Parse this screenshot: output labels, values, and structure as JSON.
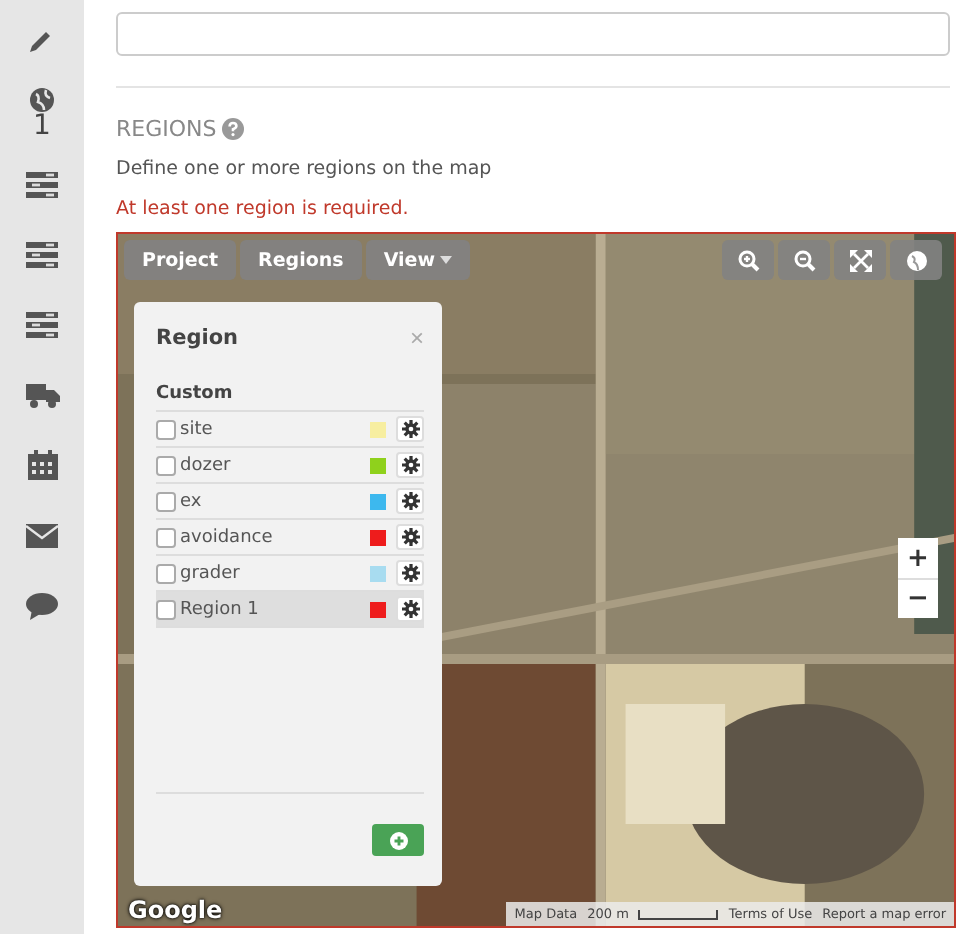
{
  "sidebar": {
    "items": [
      {
        "kind": "pencil"
      },
      {
        "kind": "globe",
        "count": "1"
      },
      {
        "kind": "list"
      },
      {
        "kind": "list"
      },
      {
        "kind": "list"
      },
      {
        "kind": "truck"
      },
      {
        "kind": "calendar"
      },
      {
        "kind": "envelope"
      },
      {
        "kind": "chat"
      }
    ]
  },
  "section": {
    "title": "REGIONS",
    "description": "Define one or more regions on the map",
    "error": "At least one region is required."
  },
  "map": {
    "toolbar": [
      {
        "label": "Project",
        "caret": false
      },
      {
        "label": "Regions",
        "caret": false
      },
      {
        "label": "View",
        "caret": true
      }
    ],
    "tools": [
      {
        "kind": "zoom-in"
      },
      {
        "kind": "zoom-out"
      },
      {
        "kind": "fullscreen"
      },
      {
        "kind": "globe"
      }
    ],
    "zoom": [
      "+",
      "−"
    ],
    "panel": {
      "title": "Region",
      "close": "×",
      "group": "Custom",
      "regions": [
        {
          "name": "site",
          "checked": false,
          "color": "#f7eea0",
          "selected": false
        },
        {
          "name": "dozer",
          "checked": false,
          "color": "#8fd11c",
          "selected": false
        },
        {
          "name": "ex",
          "checked": false,
          "color": "#3db8ee",
          "selected": false
        },
        {
          "name": "avoidance",
          "checked": false,
          "color": "#ee1c1c",
          "selected": false
        },
        {
          "name": "grader",
          "checked": false,
          "color": "#a8dcf0",
          "selected": false
        },
        {
          "name": "Region 1",
          "checked": false,
          "color": "#ee1c1c",
          "selected": true
        }
      ]
    },
    "logo": "Google",
    "attribution": [
      "Map Data",
      "200 m",
      "Terms of Use",
      "Report a map error"
    ]
  }
}
